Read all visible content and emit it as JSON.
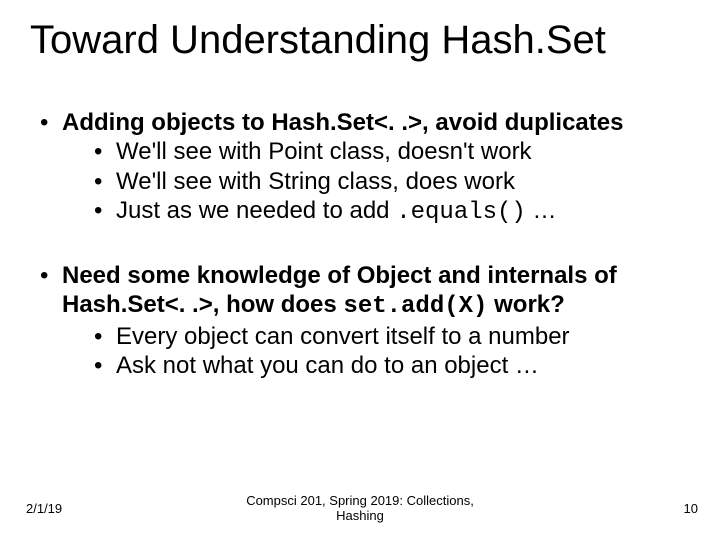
{
  "title": "Toward Understanding Hash.Set",
  "bullets": {
    "b1": {
      "lead": "Adding objects to Hash.Set<. .>, avoid duplicates",
      "sub1": "We'll see with Point class, doesn't work",
      "sub2": "We'll see with String class, does work",
      "sub3_pre": "Just as we needed to add ",
      "sub3_code": ".equals()",
      "sub3_post": " …"
    },
    "b2": {
      "lead_pre": "Need some knowledge of Object and internals of Hash.Set<. .>, how does ",
      "lead_code": "set.add(X)",
      "lead_post": " work?",
      "sub1": "Every object can convert itself to a number",
      "sub2": "Ask not what you can do to an object …"
    }
  },
  "footer": {
    "date": "2/1/19",
    "center_line1": "Compsci 201, Spring 2019: Collections,",
    "center_line2": "Hashing",
    "page": "10"
  }
}
